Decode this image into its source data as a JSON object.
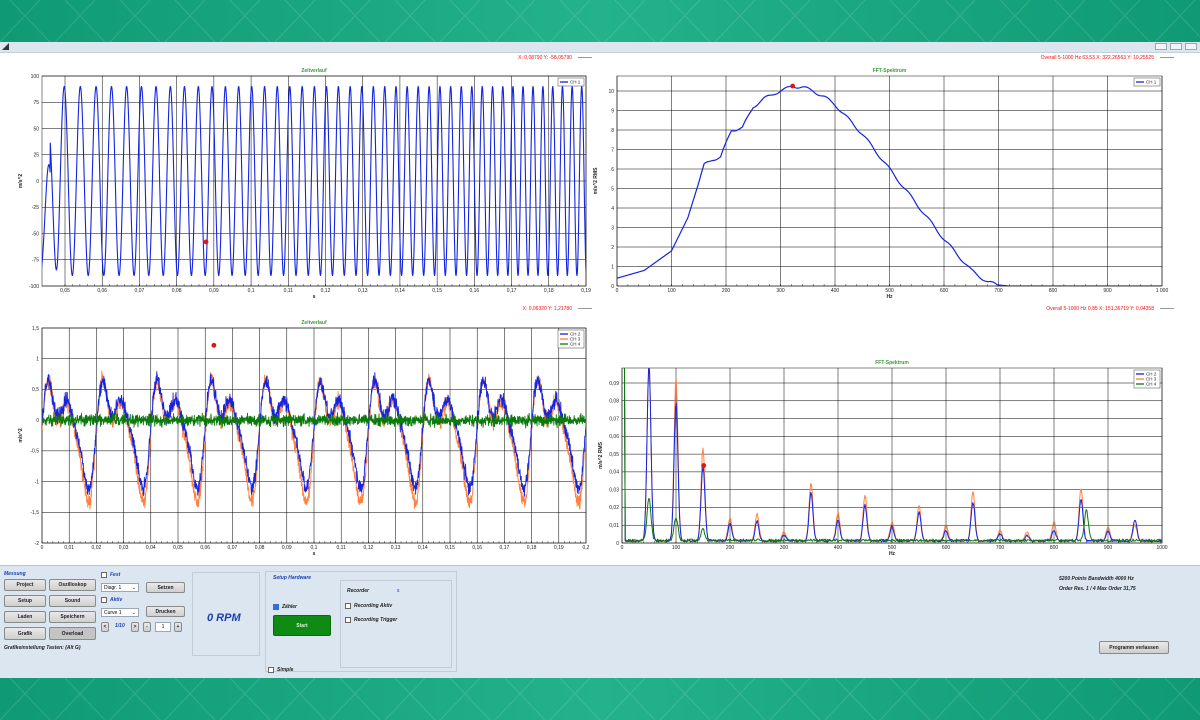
{
  "colors": {
    "ch1": "#1424e0",
    "ch2": "#1424e0",
    "ch3": "#ff8040",
    "ch4": "#0a7a0a",
    "marker": "#e81010",
    "title": "#3a9a3a"
  },
  "charts": {
    "c1": {
      "title": "Zeitverlauf",
      "readout": "X: 0,08790   Y: -58,05790",
      "ylabel": "m/s^2",
      "xlabel": "s",
      "yticks": [
        "100",
        "75",
        "50",
        "25",
        "0",
        "-25",
        "-50",
        "-75",
        "-100"
      ],
      "xticks": [
        "0,05",
        "0,06",
        "0,07",
        "0,08",
        "0,09",
        "0,1",
        "0,11",
        "0,12",
        "0,13",
        "0,14",
        "0,15",
        "0,16",
        "0,17",
        "0,18",
        "0,19"
      ],
      "legend": [
        "CH 1"
      ]
    },
    "c2": {
      "title": "FFT-Spektrum",
      "readout": "Overall 5-1000 Hz 63,53   X: 322,26563   Y: 10,25525",
      "ylabel": "m/s^2 RMS",
      "xlabel": "Hz",
      "yticks": [
        "10",
        "9",
        "8",
        "7",
        "6",
        "5",
        "4",
        "3",
        "2",
        "1",
        "0"
      ],
      "xticks": [
        "0",
        "100",
        "200",
        "300",
        "400",
        "500",
        "600",
        "700",
        "800",
        "900",
        "1 000"
      ],
      "legend": [
        "CH 1"
      ]
    },
    "c3": {
      "title": "Zeitverlauf",
      "readout": "X: 0,06320   Y: 1,21780",
      "ylabel": "m/s^2",
      "xlabel": "s",
      "yticks": [
        "1,5",
        "1",
        "0,5",
        "0",
        "-0,5",
        "-1",
        "-1,5",
        "-2"
      ],
      "xticks": [
        "0",
        "0,01",
        "0,02",
        "0,03",
        "0,04",
        "0,05",
        "0,06",
        "0,07",
        "0,08",
        "0,09",
        "0,1",
        "0,11",
        "0,12",
        "0,13",
        "0,14",
        "0,15",
        "0,16",
        "0,17",
        "0,18",
        "0,19",
        "0,2"
      ],
      "legend": [
        "CH 2",
        "CH 3",
        "CH 4"
      ]
    },
    "c4": {
      "title": "FFT-Spektrum",
      "readout": "Overall 5-1000 Hz 0,85   X: 151,36719   Y: 0,04358",
      "ylabel": "m/s^2 RMS",
      "xlabel": "Hz",
      "yticks": [
        "0,09",
        "0,08",
        "0,07",
        "0,06",
        "0,05",
        "0,04",
        "0,03",
        "0,02",
        "0,01",
        "0"
      ],
      "xticks": [
        "0",
        "100",
        "200",
        "300",
        "400",
        "500",
        "600",
        "700",
        "800",
        "900",
        "1000"
      ],
      "legend": [
        "CH 2",
        "CH 3",
        "CH 4"
      ]
    }
  },
  "chart_data": [
    {
      "type": "line",
      "title": "Zeitverlauf",
      "xlabel": "s",
      "ylabel": "m/s^2",
      "xlim": [
        0.042,
        0.197
      ],
      "ylim": [
        -100,
        100
      ],
      "series": [
        {
          "name": "CH 1",
          "description": "chirp sine, amplitude about 90, frequency increasing from about 220 Hz to about 400 Hz"
        }
      ],
      "marker": {
        "x": 0.0879,
        "y": -58.0579
      }
    },
    {
      "type": "line",
      "title": "FFT-Spektrum",
      "xlabel": "Hz",
      "ylabel": "m/s^2 RMS",
      "xlim": [
        0,
        1000
      ],
      "ylim": [
        0,
        10.5
      ],
      "series": [
        {
          "name": "CH 1",
          "x": [
            0,
            50,
            100,
            130,
            160,
            175,
            190,
            210,
            230,
            250,
            270,
            290,
            310,
            322,
            340,
            360,
            380,
            400,
            450,
            500,
            550,
            600,
            650,
            680,
            700,
            720,
            800,
            900,
            1000
          ],
          "y": [
            0.4,
            0.8,
            1.8,
            3.5,
            6.2,
            6.5,
            6.6,
            8.0,
            8.1,
            9.2,
            9.6,
            9.9,
            10.1,
            10.25,
            10.2,
            10.0,
            9.7,
            9.3,
            7.8,
            6.0,
            4.2,
            2.4,
            0.8,
            0.2,
            0.05,
            0.0,
            0.0,
            0.0,
            0.0
          ]
        }
      ],
      "marker": {
        "x": 322.26563,
        "y": 10.25525
      }
    },
    {
      "type": "line",
      "title": "Zeitverlauf",
      "xlabel": "s",
      "ylabel": "m/s^2",
      "xlim": [
        0,
        0.2
      ],
      "ylim": [
        -2.1,
        1.5
      ],
      "series": [
        {
          "name": "CH 2",
          "description": "50 Hz periodic, peaks about +1.0, troughs about -1.5, noisy"
        },
        {
          "name": "CH 3",
          "description": "50 Hz periodic, peaks about +0.9, troughs about -1.8, noisy"
        },
        {
          "name": "CH 4",
          "description": "noise around 0, amplitude about 0.2"
        }
      ],
      "marker": {
        "x": 0.0632,
        "y": 1.2178
      }
    },
    {
      "type": "line",
      "title": "FFT-Spektrum",
      "xlabel": "Hz",
      "ylabel": "m/s^2 RMS",
      "xlim": [
        0,
        1000
      ],
      "ylim": [
        0,
        0.1
      ],
      "series": [
        {
          "name": "CH 2",
          "peaks_x": [
            50,
            100,
            150,
            200,
            250,
            300,
            350,
            400,
            450,
            500,
            550,
            600,
            650,
            700,
            750,
            800,
            850,
            900,
            950
          ],
          "peaks_y": [
            0.1,
            0.078,
            0.042,
            0.01,
            0.011,
            0.003,
            0.027,
            0.012,
            0.02,
            0.008,
            0.016,
            0.006,
            0.022,
            0.004,
            0.003,
            0.006,
            0.024,
            0.006,
            0.012
          ]
        },
        {
          "name": "CH 3",
          "peaks_x": [
            50,
            100,
            150,
            200,
            250,
            300,
            350,
            400,
            450,
            500,
            550,
            600,
            650,
            700,
            750,
            800,
            850,
            900,
            950
          ],
          "peaks_y": [
            0.1,
            0.092,
            0.052,
            0.013,
            0.015,
            0.005,
            0.033,
            0.016,
            0.026,
            0.011,
            0.02,
            0.009,
            0.028,
            0.006,
            0.005,
            0.011,
            0.03,
            0.008,
            0.009
          ]
        },
        {
          "name": "CH 4",
          "peaks_x": [
            50,
            100,
            150,
            860
          ],
          "peaks_y": [
            0.024,
            0.013,
            0.006,
            0.017
          ]
        }
      ],
      "marker": {
        "x": 151.36719,
        "y": 0.04358
      }
    }
  ],
  "panel": {
    "messung": "Messung",
    "project": "Project",
    "oszilloskop": "Oszilloskop",
    "setup": "Setup",
    "sound": "Sound",
    "laden": "Laden",
    "speichern": "Speichern",
    "grafik": "Grafik",
    "overload": "Overload",
    "fest": "Fest",
    "diagr": "Diagr. 1",
    "setzen": "Setzen",
    "aktiv": "Aktiv",
    "curve": "Curve 1",
    "drucken": "Drucken",
    "pager_prev": "<",
    "pager_text": "1/10",
    "pager_next": ">",
    "minus": "-",
    "num": "1",
    "plus": "+",
    "rpm": "0 RPM",
    "shortcut": "Grafikeinstellung Tasten: (Alt G)",
    "setup_hw": "Setup Hardware",
    "zaehler": "Zähler",
    "start": "Start",
    "simple": "Simple",
    "recorder": "Recorder",
    "recorder_val": "s",
    "rec_aktiv": "Recording Aktiv",
    "rec_trigger": "Recording Trigger",
    "info1": "5200 Points  Bandwidth 4000 Hz",
    "info2": "Order Res.  1 / 4 Max Order 31,75",
    "exit": "Programm verlassen"
  }
}
